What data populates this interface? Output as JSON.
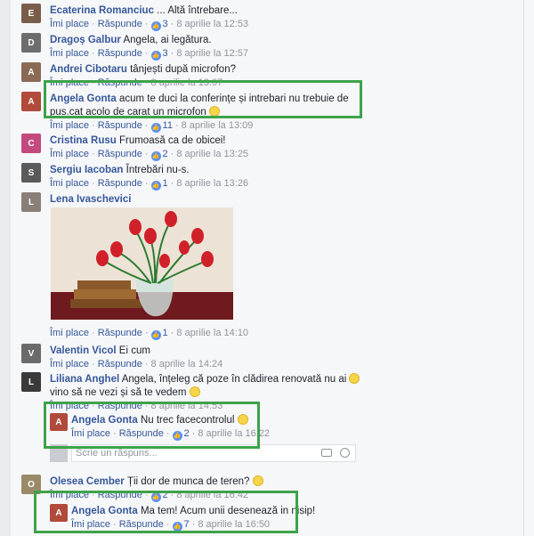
{
  "common": {
    "like_label": "Îmi place",
    "reply_label": "Răspunde",
    "sep": "·"
  },
  "comments": [
    {
      "name": "Ecaterina Romanciuc",
      "text": "... Altă întrebare...",
      "likes": "3",
      "time": "8 aprilie la 12:53"
    },
    {
      "name": "Dragoș Galbur",
      "text": "Angela, ai legătura.",
      "likes": "3",
      "time": "8 aprilie la 12:57"
    },
    {
      "name": "Andrei Cibotaru",
      "text": "tânjești după microfon?",
      "likes": "",
      "time": "8 aprilie la 13:07"
    },
    {
      "name": "Angela Gonta",
      "text": "acum te duci la conferințe și intrebari nu trebuie de pus.cat acolo de carat un microfon",
      "likes": "11",
      "time": "8 aprilie la 13:09"
    },
    {
      "name": "Cristina Rusu",
      "text": "Frumoasă ca de obicei!",
      "likes": "2",
      "time": "8 aprilie la 13:25"
    },
    {
      "name": "Sergiu Iacoban",
      "text": "Întrebări nu-s.",
      "likes": "1",
      "time": "8 aprilie la 13:26"
    },
    {
      "name": "Lena Ivaschevici",
      "text": "",
      "likes": "1",
      "time": "8 aprilie la 14:10"
    },
    {
      "name": "Valentin Vicol",
      "text": "Ei cum",
      "likes": "",
      "time": "8 aprilie la 14:24"
    },
    {
      "name": "Liliana Anghel",
      "text": "Angela, înțeleg că poze în clădirea renovată nu ai",
      "text2": "vino să ne vezi și să te vedem",
      "likes": "",
      "time": "8 aprilie la 14:53"
    },
    {
      "name": "Angela Gonta",
      "text": "Nu trec facecontrolul",
      "likes": "2",
      "time": "8 aprilie la 16:22"
    },
    {
      "name": "Olesea Cember",
      "text": "Ții dor de munca de teren?",
      "likes": "2",
      "time": "8 aprilie la 16:42"
    },
    {
      "name": "Angela Gonta",
      "text": "Ma tem! Acum unii desenează in nisip!",
      "likes": "7",
      "time": "8 aprilie la 16:50"
    }
  ],
  "reply_input": {
    "placeholder": "Scrie un răspuns..."
  },
  "icons": {
    "like": "thumbs-up-icon",
    "camera": "camera-icon",
    "sticker": "sticker-icon",
    "emoji": "smiley-emoji-icon"
  },
  "colors": {
    "link": "#365899",
    "highlight": "#3ea34a",
    "like_badge": "#5890ff"
  }
}
